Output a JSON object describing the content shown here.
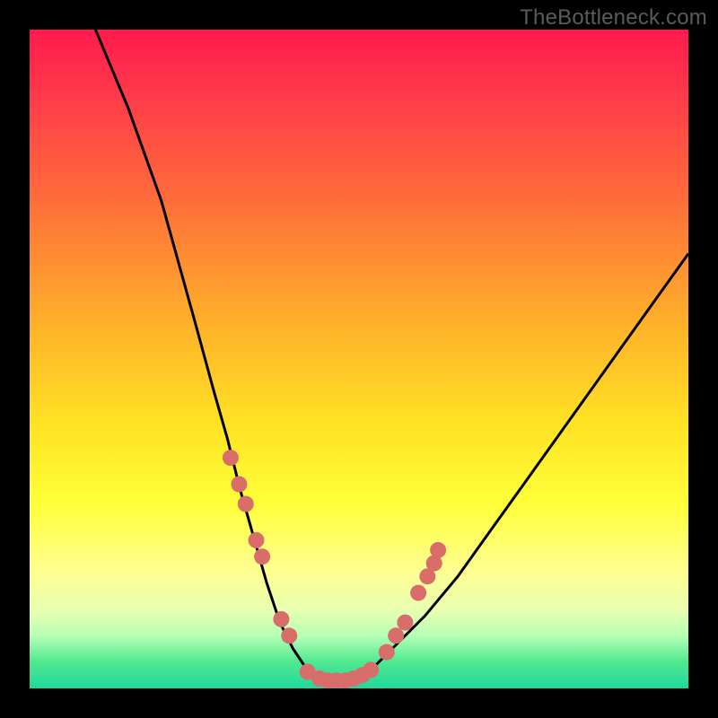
{
  "watermark": "TheBottleneck.com",
  "colors": {
    "frame": "#000000",
    "gradient_top": "#ff1a4d",
    "gradient_mid": "#ffe324",
    "gradient_bottom": "#1fd89c",
    "curve_stroke": "#000000",
    "dot_fill": "#d96d6a"
  },
  "chart_data": {
    "type": "line",
    "title": "",
    "xlabel": "",
    "ylabel": "",
    "xlim": [
      0,
      100
    ],
    "ylim": [
      0,
      100
    ],
    "series": [
      {
        "name": "bottleneck-curve",
        "x": [
          10,
          15,
          20,
          25,
          28,
          30,
          32,
          34,
          36,
          38,
          40,
          42,
          44,
          46,
          48,
          50,
          52,
          55,
          60,
          65,
          70,
          75,
          80,
          85,
          90,
          95,
          100
        ],
        "y": [
          100,
          88,
          74,
          56,
          45,
          38,
          30,
          23,
          16,
          10,
          6,
          3,
          1.5,
          1,
          1,
          1.5,
          3,
          6,
          11,
          17,
          24,
          31,
          38,
          45,
          52,
          59,
          66
        ]
      }
    ],
    "dots": {
      "name": "highlighted-points",
      "x": [
        30.5,
        31.8,
        32.8,
        34.4,
        35.3,
        38.2,
        39.4,
        42.2,
        44.0,
        45.3,
        46.6,
        47.9,
        49.2,
        50.5,
        51.8,
        54.2,
        55.6,
        57.0,
        59.0,
        60.4,
        61.4,
        62.0
      ],
      "y": [
        35.0,
        31.0,
        28.0,
        22.5,
        20.0,
        10.5,
        8.0,
        2.5,
        1.5,
        1.2,
        1.2,
        1.2,
        1.5,
        2.0,
        2.8,
        5.5,
        8.0,
        10.0,
        14.5,
        17.0,
        19.0,
        21.0
      ]
    }
  }
}
